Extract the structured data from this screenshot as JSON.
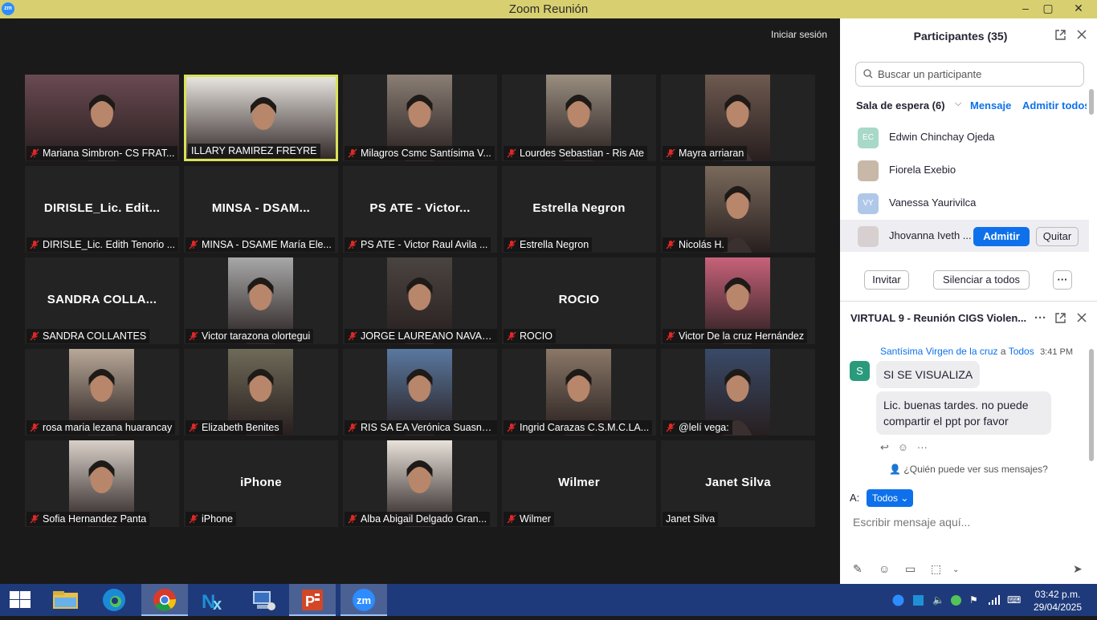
{
  "window": {
    "title": "Zoom Reunión",
    "logo_text": "zm",
    "minimize": "‒",
    "maximize": "▢",
    "close": "✕"
  },
  "meeting": {
    "sign_in": "Iniciar sesión",
    "tiles": [
      {
        "tag": "Mariana Simbron- CS FRAT...",
        "muted": true,
        "video": true,
        "full": true,
        "bg": "#6a4a52"
      },
      {
        "tag": "ILLARY RAMIREZ FREYRE",
        "muted": false,
        "video": true,
        "full": true,
        "active": true,
        "bg": "#e8e4df"
      },
      {
        "tag": "Milagros Csmc Santísima V...",
        "muted": true,
        "video": true,
        "bg": "#8a7e74"
      },
      {
        "tag": "Lourdes Sebastian - Ris Ate",
        "muted": true,
        "video": true,
        "bg": "#9a8e80"
      },
      {
        "tag": "Mayra arriaran",
        "muted": true,
        "video": true,
        "bg": "#6e5a50"
      },
      {
        "tag": "DIRISLE_Lic. Edith Tenorio ...",
        "muted": true,
        "bigname": "DIRISLE_Lic.  Edit..."
      },
      {
        "tag": "MINSA - DSAME María Ele...",
        "muted": true,
        "bigname": "MINSA  -  DSAM..."
      },
      {
        "tag": "PS ATE - Victor Raul Avila ...",
        "muted": true,
        "bigname": "PS ATE  -  Victor..."
      },
      {
        "tag": "Estrella Negron",
        "muted": true,
        "bigname": "Estrella Negron"
      },
      {
        "tag": "Nicolás H.",
        "muted": true,
        "video": true,
        "bg": "#7a6a5c"
      },
      {
        "tag": "SANDRA COLLANTES",
        "muted": true,
        "bigname": "SANDRA  COLLA..."
      },
      {
        "tag": "Victor tarazona olortegui",
        "muted": true,
        "video": true,
        "bg": "#a8a8a8"
      },
      {
        "tag": "JORGE LAUREANO NAVAR...",
        "muted": true,
        "video": true,
        "bg": "#4a4440"
      },
      {
        "tag": "ROCIO",
        "muted": true,
        "bigname": "ROCIO"
      },
      {
        "tag": "Victor De la cruz Hernández",
        "muted": true,
        "video": true,
        "bg": "#c8627a"
      },
      {
        "tag": "rosa maria lezana huarancay",
        "muted": true,
        "video": true,
        "bg": "#b8a898"
      },
      {
        "tag": "Elizabeth Benites",
        "muted": true,
        "video": true,
        "bg": "#6e6a58"
      },
      {
        "tag": "RIS SA EA Verónica Suasna...",
        "muted": true,
        "video": true,
        "bg": "#5a78a0"
      },
      {
        "tag": "Ingrid  Carazas C.S.M.C.LA...",
        "muted": true,
        "video": true,
        "bg": "#8a7868"
      },
      {
        "tag": "@lelí vega:",
        "muted": true,
        "video": true,
        "bg": "#3a4a68"
      },
      {
        "tag": "Sofia Hernandez Panta",
        "muted": true,
        "video": true,
        "bg": "#d8d0c8"
      },
      {
        "tag": "iPhone",
        "muted": true,
        "bigname": "iPhone"
      },
      {
        "tag": "Alba Abigail Delgado Gran...",
        "muted": true,
        "video": true,
        "bg": "#e8e2da"
      },
      {
        "tag": "Wilmer",
        "muted": true,
        "bigname": "Wilmer"
      },
      {
        "tag": "Janet Silva",
        "muted": false,
        "bigname": "Janet Silva"
      }
    ]
  },
  "participants": {
    "title": "Participantes (35)",
    "search_placeholder": "Buscar un participante",
    "waiting_label": "Sala de espera (6)",
    "message": "Mensaje",
    "admit_all": "Admitir todos",
    "waiting": [
      {
        "name": "Edwin Chinchay Ojeda",
        "initials": "EC",
        "color": "#a8d8c8"
      },
      {
        "name": "Fiorela Exebio",
        "initials": "",
        "color": "#c8b8a8"
      },
      {
        "name": "Vanessa Yaurivilca",
        "initials": "VY",
        "color": "#b0c8e8"
      },
      {
        "name": "Jhovanna Iveth ...",
        "initials": "",
        "color": "#d8d0d0"
      }
    ],
    "admit": "Admitir",
    "remove": "Quitar",
    "invite": "Invitar",
    "mute_all": "Silenciar a todos",
    "more": "···"
  },
  "chat": {
    "title": "VIRTUAL 9 - Reunión CIGS Violen...",
    "sender": "Santísima Virgen de la cruz",
    "to_word": "a",
    "to": "Todos",
    "time": "3:41 PM",
    "avatar": "S",
    "messages": [
      "SI SE VISUALIZA",
      "Lic. buenas tardes. no puede compartir el ppt por favor"
    ],
    "who_can_see": "¿Quién puede ver sus mensajes?",
    "to_label": "A:",
    "to_select": "Todos",
    "input_placeholder": "Escribir mensaje aquí..."
  },
  "taskbar": {
    "clock_time": "03:42 p.m.",
    "clock_date": "29/04/2025",
    "zoom_label": "zm"
  }
}
